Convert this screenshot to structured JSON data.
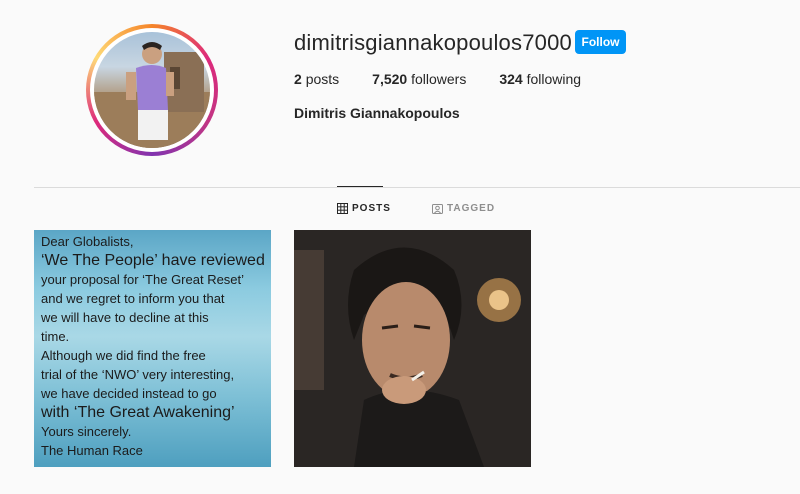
{
  "profile": {
    "username": "dimitrisgiannakopoulos7000",
    "follow_label": "Follow",
    "posts_count": "2",
    "posts_label": "posts",
    "followers_count": "7,520",
    "followers_label": "followers",
    "following_count": "324",
    "following_label": "following",
    "full_name": "Dimitris Giannakopoulos"
  },
  "tabs": [
    {
      "label": "POSTS",
      "icon": "grid-icon",
      "active": true
    },
    {
      "label": "TAGGED",
      "icon": "tag-icon",
      "active": false
    }
  ],
  "posts": [
    {
      "lines": [
        "Dear Globalists,",
        "‘We The People’ have reviewed",
        "your proposal for ‘The Great Reset’",
        "and we regret to inform you that",
        "we will have to decline at this",
        "time.",
        "Although we did find the free",
        "trial of the ‘NWO’ very interesting,",
        "we have decided instead to go",
        "with ‘The Great Awakening’",
        "Yours sincerely.",
        "The Human Race"
      ]
    },
    {
      "type": "photo"
    }
  ],
  "colors": {
    "accent": "#0095f6",
    "text": "#262626",
    "muted": "#8e8e8e"
  }
}
